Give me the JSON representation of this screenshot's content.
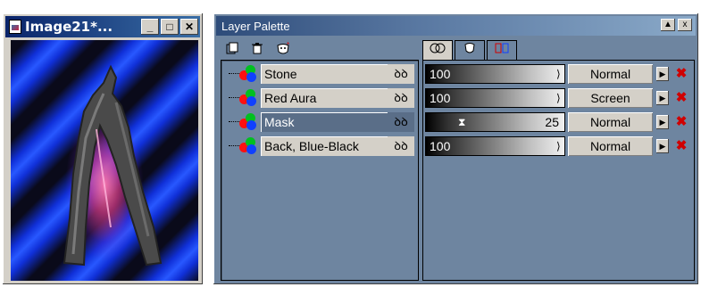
{
  "image_window": {
    "title": "Image21*...",
    "buttons": [
      "_",
      "□",
      "✕"
    ]
  },
  "palette": {
    "title": "Layer Palette",
    "title_buttons": [
      "▲",
      "x"
    ],
    "toolbar_icons": [
      "new-layer-icon",
      "delete-layer-icon",
      "mask-icon"
    ],
    "tabs": [
      "tab-layer",
      "tab-mask",
      "tab-links"
    ],
    "layers": [
      {
        "name": "Stone",
        "visible_icon": "ꝺꝺ",
        "opacity": "100",
        "blend": "Normal",
        "selected": false
      },
      {
        "name": "Red Aura",
        "visible_icon": "ꝺꝺ",
        "opacity": "100",
        "blend": "Screen",
        "selected": false
      },
      {
        "name": "Mask",
        "visible_icon": "ꝺꝺ",
        "opacity": "25",
        "blend": "Normal",
        "selected": true
      },
      {
        "name": "Back, Blue-Black",
        "visible_icon": "ꝺꝺ",
        "opacity": "100",
        "blend": "Normal",
        "selected": false
      }
    ]
  },
  "colors": {
    "panel": "#6e85a0",
    "selected": "#5a6e88",
    "title_bar": "#0a246a"
  }
}
